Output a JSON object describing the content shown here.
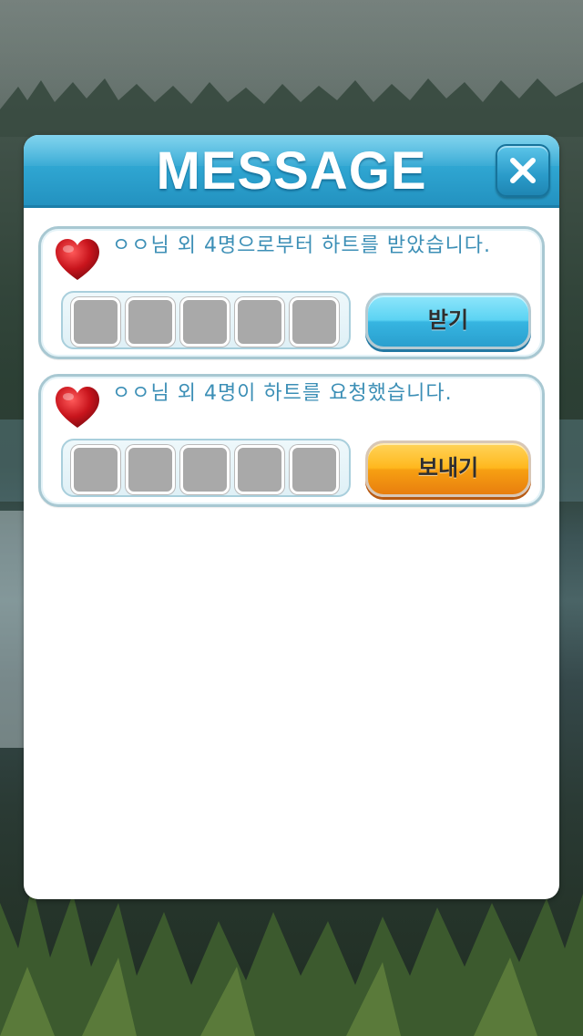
{
  "dialog": {
    "title": "MESSAGE",
    "close_icon": "close-icon"
  },
  "messages": [
    {
      "icon": "heart-icon",
      "text": "ㅇㅇ님 외 4명으로부터 하트를 받았습니다.",
      "slot_count": 5,
      "button_label": "받기",
      "button_color": "#4cc8ee"
    },
    {
      "icon": "heart-icon",
      "text": "ㅇㅇ님 외 4명이 하트를 요청했습니다.",
      "slot_count": 5,
      "button_label": "보내기",
      "button_color": "#ffb020"
    }
  ],
  "colors": {
    "header_blue": "#2fa6d2",
    "message_text": "#3c8fb6",
    "slot_placeholder": "#a9a9a9",
    "heart_red": "#c8141c"
  }
}
